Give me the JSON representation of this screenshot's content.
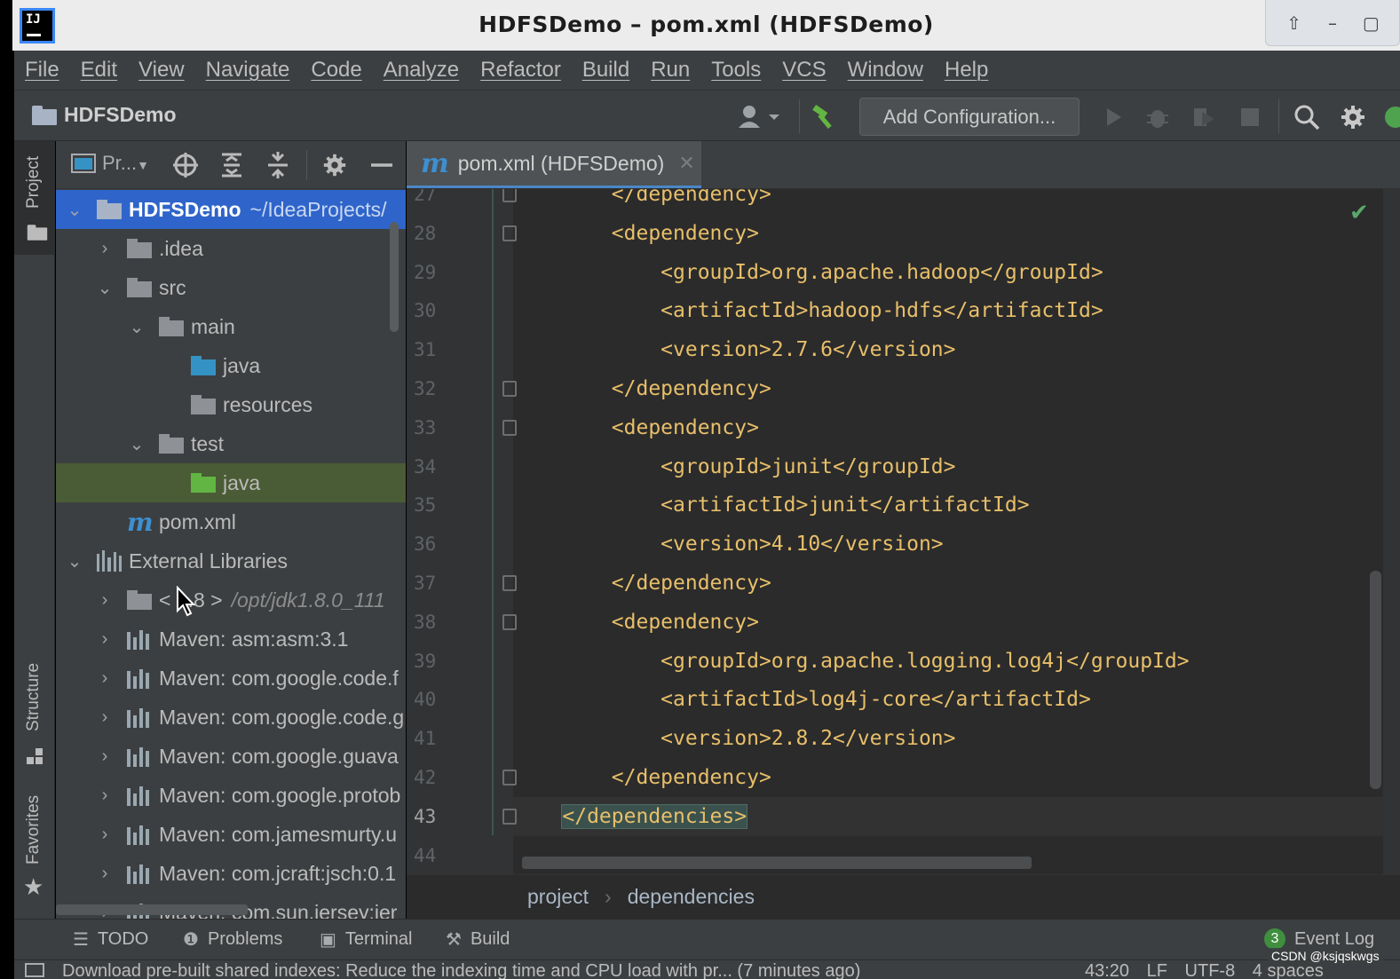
{
  "window": {
    "title": "HDFSDemo – pom.xml (HDFSDemo)",
    "logo_text": "IJ",
    "controls": [
      "⇧",
      "–",
      "▢"
    ]
  },
  "menu": [
    "File",
    "Edit",
    "View",
    "Navigate",
    "Code",
    "Analyze",
    "Refactor",
    "Build",
    "Run",
    "Tools",
    "VCS",
    "Window",
    "Help"
  ],
  "navbar": {
    "project_name": "HDFSDemo",
    "add_configuration": "Add Configuration..."
  },
  "left_strip": {
    "project_tab": "Project",
    "structure_tab": "Structure",
    "favorites_tab": "Favorites"
  },
  "project_panel": {
    "view_selector": "Pr...",
    "tree": [
      {
        "label": "HDFSDemo",
        "hint": "~/IdeaProjects/",
        "icon": "project-folder-icon",
        "expanded": true,
        "selected": true
      },
      {
        "label": ".idea",
        "icon": "folder-icon",
        "expanded": false
      },
      {
        "label": "src",
        "icon": "folder-icon",
        "expanded": true
      },
      {
        "label": "main",
        "icon": "folder-icon",
        "expanded": true
      },
      {
        "label": "java",
        "icon": "source-folder-icon"
      },
      {
        "label": "resources",
        "icon": "resources-folder-icon"
      },
      {
        "label": "test",
        "icon": "folder-icon",
        "expanded": true
      },
      {
        "label": "java",
        "icon": "test-folder-icon",
        "highlighted": true
      },
      {
        "label": "pom.xml",
        "icon": "maven-icon"
      },
      {
        "label": "External Libraries",
        "icon": "libraries-icon",
        "expanded": true
      },
      {
        "label": "< 1.8 >",
        "hint": "/opt/jdk1.8.0_111",
        "icon": "jdk-icon",
        "expanded": false
      },
      {
        "label": "Maven: asm:asm:3.1",
        "icon": "library-icon",
        "expanded": false
      },
      {
        "label": "Maven: com.google.code.f",
        "icon": "library-icon",
        "expanded": false
      },
      {
        "label": "Maven: com.google.code.g",
        "icon": "library-icon",
        "expanded": false
      },
      {
        "label": "Maven: com.google.guava",
        "icon": "library-icon",
        "expanded": false
      },
      {
        "label": "Maven: com.google.protob",
        "icon": "library-icon",
        "expanded": false
      },
      {
        "label": "Maven: com.jamesmurty.u",
        "icon": "library-icon",
        "expanded": false
      },
      {
        "label": "Maven: com.jcraft:jsch:0.1",
        "icon": "library-icon",
        "expanded": false
      },
      {
        "label": "Maven: com.sun.jersey:jer",
        "icon": "library-icon",
        "expanded": false
      }
    ]
  },
  "editor": {
    "tab_label": "pom.xml (HDFSDemo)",
    "lines": [
      {
        "n": "27",
        "text": "        </dependency>"
      },
      {
        "n": "28",
        "text": "        <dependency>"
      },
      {
        "n": "29",
        "text": "            <groupId>org.apache.hadoop</groupId>"
      },
      {
        "n": "30",
        "text": "            <artifactId>hadoop-hdfs</artifactId>"
      },
      {
        "n": "31",
        "text": "            <version>2.7.6</version>"
      },
      {
        "n": "32",
        "text": "        </dependency>"
      },
      {
        "n": "33",
        "text": "        <dependency>"
      },
      {
        "n": "34",
        "text": "            <groupId>junit</groupId>"
      },
      {
        "n": "35",
        "text": "            <artifactId>junit</artifactId>"
      },
      {
        "n": "36",
        "text": "            <version>4.10</version>"
      },
      {
        "n": "37",
        "text": "        </dependency>"
      },
      {
        "n": "38",
        "text": "        <dependency>"
      },
      {
        "n": "39",
        "text": "            <groupId>org.apache.logging.log4j</groupId>"
      },
      {
        "n": "40",
        "text": "            <artifactId>log4j-core</artifactId>"
      },
      {
        "n": "41",
        "text": "            <version>2.8.2</version>"
      },
      {
        "n": "42",
        "text": "        </dependency>"
      },
      {
        "n": "43",
        "text": "    </dependencies>",
        "current": true
      },
      {
        "n": "44",
        "text": ""
      }
    ]
  },
  "breadcrumbs": [
    "project",
    "dependencies"
  ],
  "bottom_tools": {
    "todo": "TODO",
    "problems": "Problems",
    "terminal": "Terminal",
    "build": "Build",
    "event_log": "Event Log",
    "event_count": "3"
  },
  "status": {
    "message": "Download pre-built shared indexes: Reduce the indexing time and CPU load with pr... (7 minutes ago)",
    "position": "43:20",
    "line_sep": "LF",
    "encoding": "UTF-8",
    "indent": "4 spaces"
  },
  "watermark": "CSDN @ksjqskwgs",
  "colors": {
    "accent": "#2f65ca",
    "xml_tag": "#e8bf6a",
    "background": "#2b2b2b",
    "panel": "#3c3f41"
  }
}
